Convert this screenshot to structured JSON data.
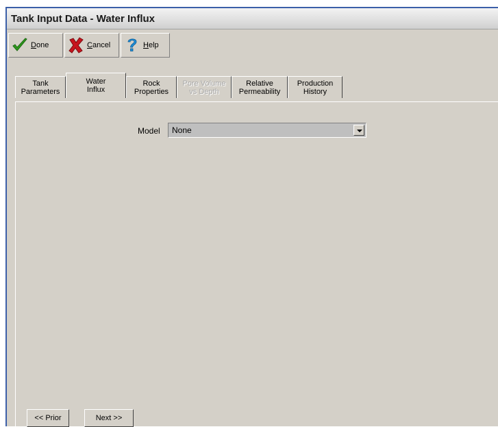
{
  "window": {
    "title": "Tank Input Data - Water Influx"
  },
  "toolbar": {
    "done_label": "one",
    "done_mnemonic": "D",
    "cancel_label": "ancel",
    "cancel_mnemonic": "C",
    "help_label": "elp",
    "help_mnemonic": "H",
    "icons": {
      "done": "checkmark-icon",
      "cancel": "x-icon",
      "help": "question-mark-icon"
    },
    "colors": {
      "done": "#2e9a1e",
      "cancel": "#c8141e",
      "help": "#1f8fd8"
    }
  },
  "tabs": [
    {
      "label": "Tank\nParameters",
      "state": "normal"
    },
    {
      "label": "Water\nInflux",
      "state": "active"
    },
    {
      "label": "Rock\nProperties",
      "state": "normal"
    },
    {
      "label": "Pore Volume\nvs Depth",
      "state": "disabled"
    },
    {
      "label": "Relative\nPermeability",
      "state": "normal"
    },
    {
      "label": "Production\nHistory",
      "state": "normal"
    }
  ],
  "form": {
    "model_label": "Model",
    "model_value": "None"
  },
  "nav": {
    "prior_label": "<< Prior",
    "next_label": "Next >>"
  }
}
